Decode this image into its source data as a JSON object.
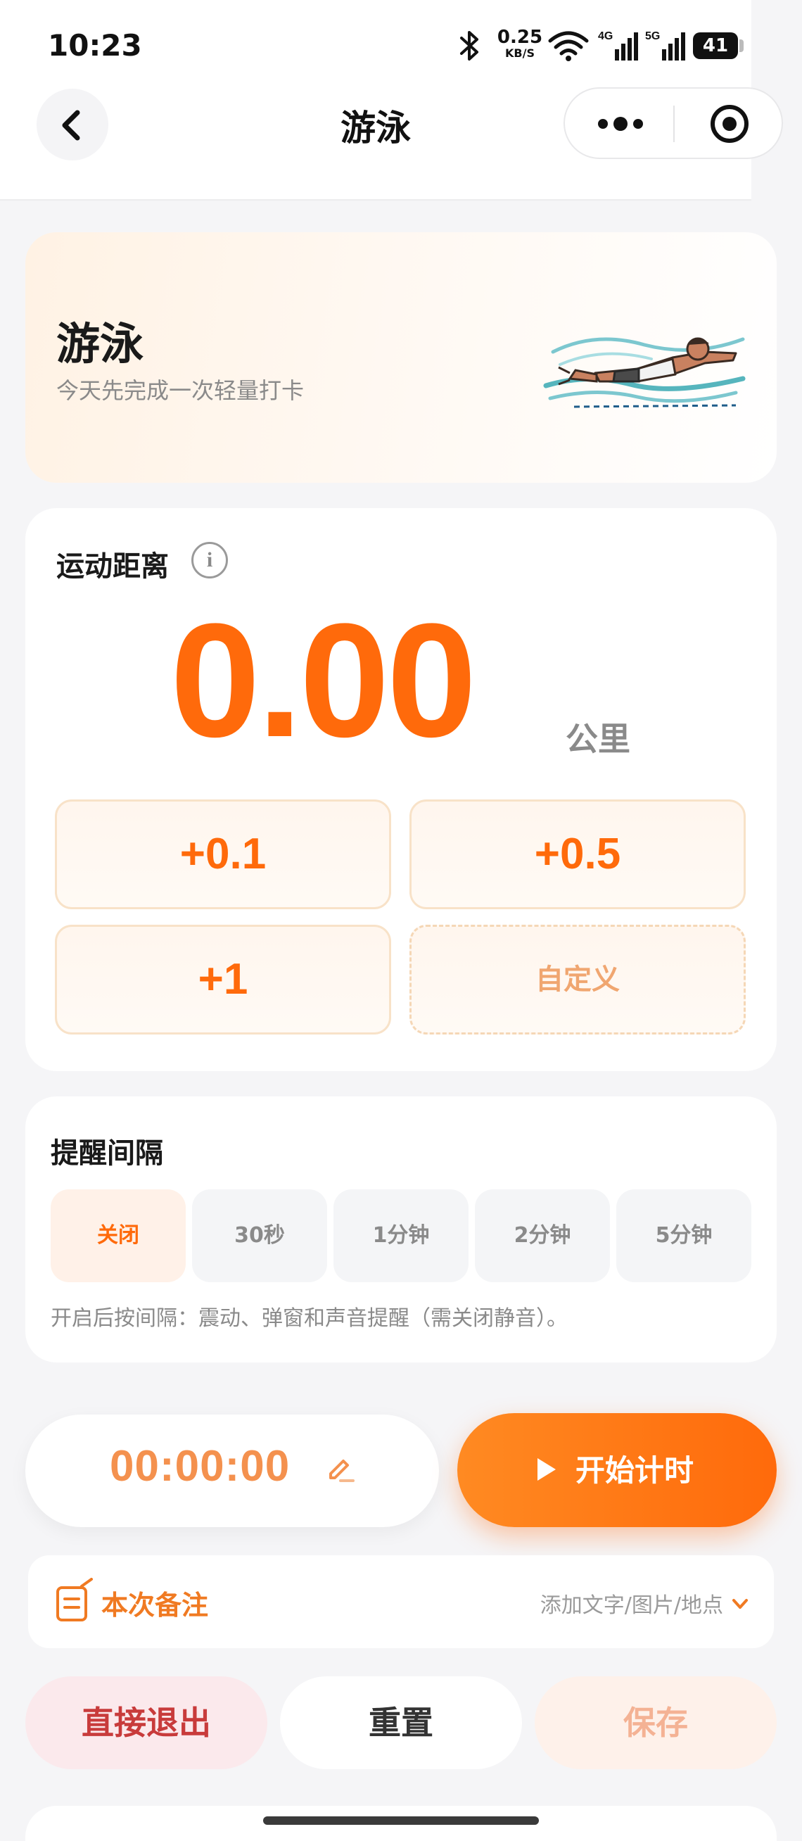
{
  "status_bar": {
    "time": "10:23",
    "net_speed_value": "0.25",
    "net_speed_unit": "KB/S",
    "network_4g": "4G",
    "network_5g": "5G",
    "battery": "41"
  },
  "nav": {
    "title": "游泳"
  },
  "hero": {
    "title": "游泳",
    "subtitle": "今天先完成一次轻量打卡"
  },
  "distance": {
    "label": "运动距离",
    "value": "0.00",
    "unit": "公里",
    "increments": [
      "+0.1",
      "+0.5",
      "+1"
    ],
    "custom_label": "自定义"
  },
  "reminder": {
    "title": "提醒间隔",
    "options": [
      "关闭",
      "30秒",
      "1分钟",
      "2分钟",
      "5分钟"
    ],
    "selected": "关闭",
    "note": "开启后按间隔：震动、弹窗和声音提醒（需关闭静音）。"
  },
  "timer": {
    "display": "00:00:00",
    "start_label": "开始计时"
  },
  "note": {
    "label": "本次备注",
    "hint": "添加文字/图片/地点"
  },
  "actions": {
    "exit": "直接退出",
    "reset": "重置",
    "save": "保存"
  },
  "colors": {
    "accent": "#ff6a0b",
    "danger": "#c83b3b",
    "background": "#f5f5f7"
  }
}
